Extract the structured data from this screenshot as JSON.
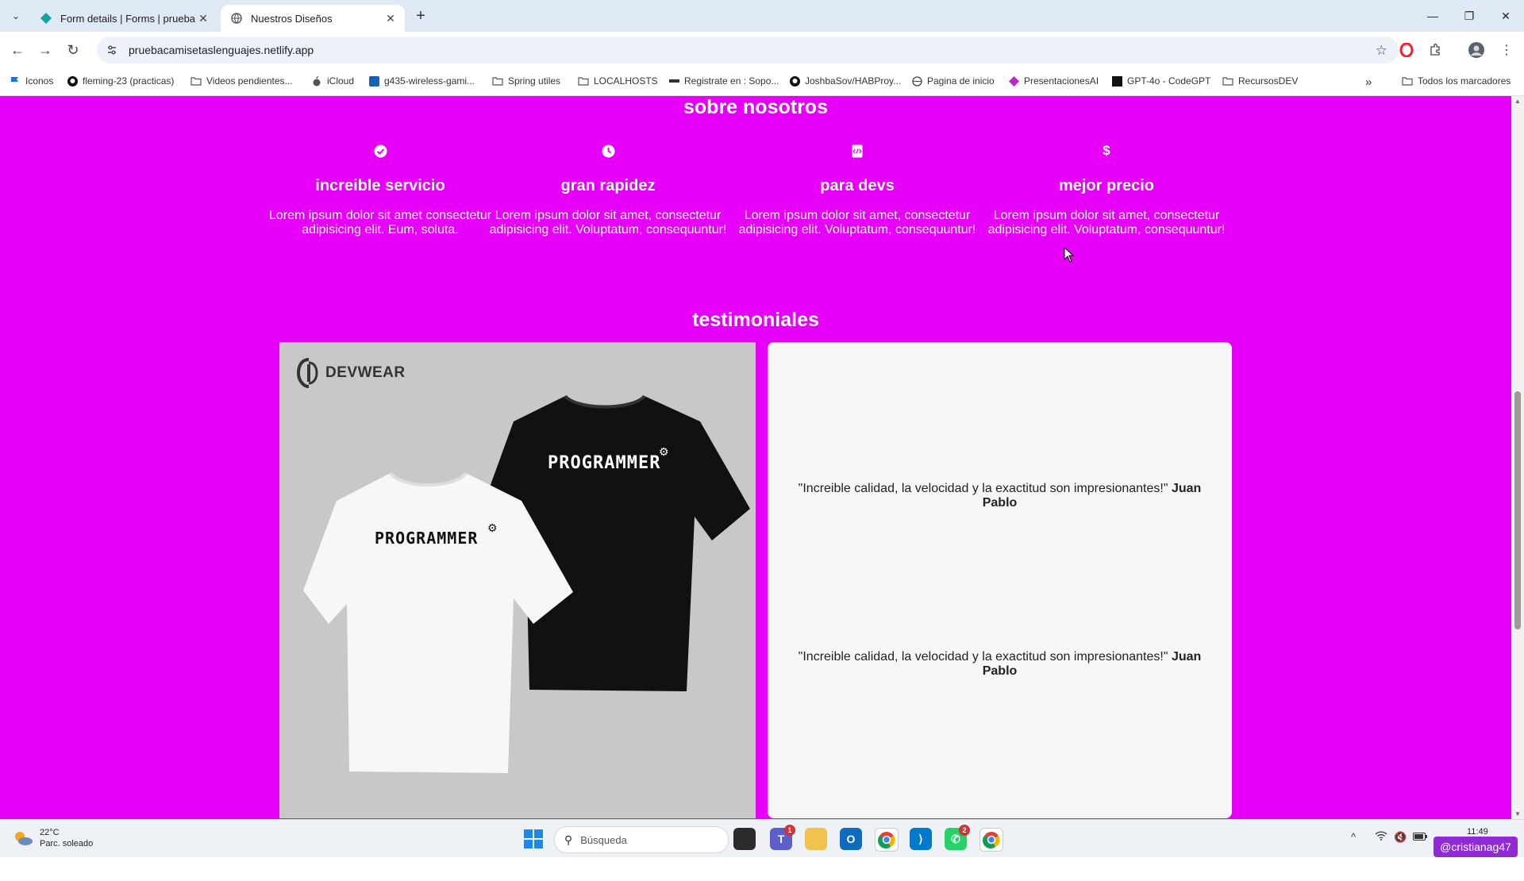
{
  "browser": {
    "tabs": [
      {
        "title": "Form details | Forms | pruebaca",
        "active": false
      },
      {
        "title": "Nuestros Diseños",
        "active": true
      }
    ],
    "url": "pruebacamisetaslenguajes.netlify.app"
  },
  "bookmarks": [
    {
      "label": "Iconos",
      "icon": "flag-icon"
    },
    {
      "label": "fleming-23 (practicas)",
      "icon": "github-icon"
    },
    {
      "label": "Videos pendientes...",
      "icon": "folder-icon"
    },
    {
      "label": "iCloud",
      "icon": "apple-icon"
    },
    {
      "label": "g435-wireless-gami...",
      "icon": "logitech-icon"
    },
    {
      "label": "Spring utiles",
      "icon": "folder-icon"
    },
    {
      "label": "LOCALHOSTS",
      "icon": "folder-icon"
    },
    {
      "label": "Registrate en : Sopo...",
      "icon": "link-icon"
    },
    {
      "label": "JoshbaSov/HABProy...",
      "icon": "github-icon"
    },
    {
      "label": "Pagina de inicio",
      "icon": "globe-icon"
    },
    {
      "label": "PresentacionesAI",
      "icon": "ai-icon"
    },
    {
      "label": "GPT-4o - CodeGPT",
      "icon": "codegpt-icon"
    },
    {
      "label": "RecursosDEV",
      "icon": "folder-icon"
    }
  ],
  "bookmarks_overflow": "»",
  "all_bookmarks": "Todos los marcadores",
  "colors": {
    "page_bg": "#e600f7",
    "card_bg": "#f6f6f6"
  },
  "about": {
    "title": "sobre nosotros",
    "features": [
      {
        "icon": "check-circle-icon",
        "name": "increible servicio",
        "desc": "Lorem ipsum dolor sit amet consectetur adipisicing elit. Eum, soluta."
      },
      {
        "icon": "clock-icon",
        "name": "gran rapidez",
        "desc": "Lorem ipsum dolor sit amet, consectetur adipisicing elit. Voluptatum, consequuntur!"
      },
      {
        "icon": "code-file-icon",
        "name": "para devs",
        "desc": "Lorem ipsum dolor sit amet, consectetur adipisicing elit. Voluptatum, consequuntur!"
      },
      {
        "icon": "dollar-icon",
        "name": "mejor precio",
        "desc": "Lorem ipsum dolor sit amet, consectetur adipisicing elit. Voluptatum, consequuntur!"
      }
    ]
  },
  "testimonials": {
    "title": "testimoniales",
    "image": {
      "brand": "DEVWEAR",
      "shirt_text": "PROGRAMMER"
    },
    "quotes": [
      {
        "text": "\"Increible calidad, la velocidad y la exactitud son impresionantes!\"",
        "author": "Juan Pablo"
      },
      {
        "text": "\"Increible calidad, la velocidad y la exactitud son impresionantes!\"",
        "author": "Juan Pablo"
      }
    ]
  },
  "taskbar": {
    "weather_temp": "22°C",
    "weather_desc": "Parc. soleado",
    "search_placeholder": "Búsqueda",
    "teams_badge": "1",
    "whatsapp_badge": "2",
    "time": "11:49",
    "user": "@cristianag47"
  }
}
